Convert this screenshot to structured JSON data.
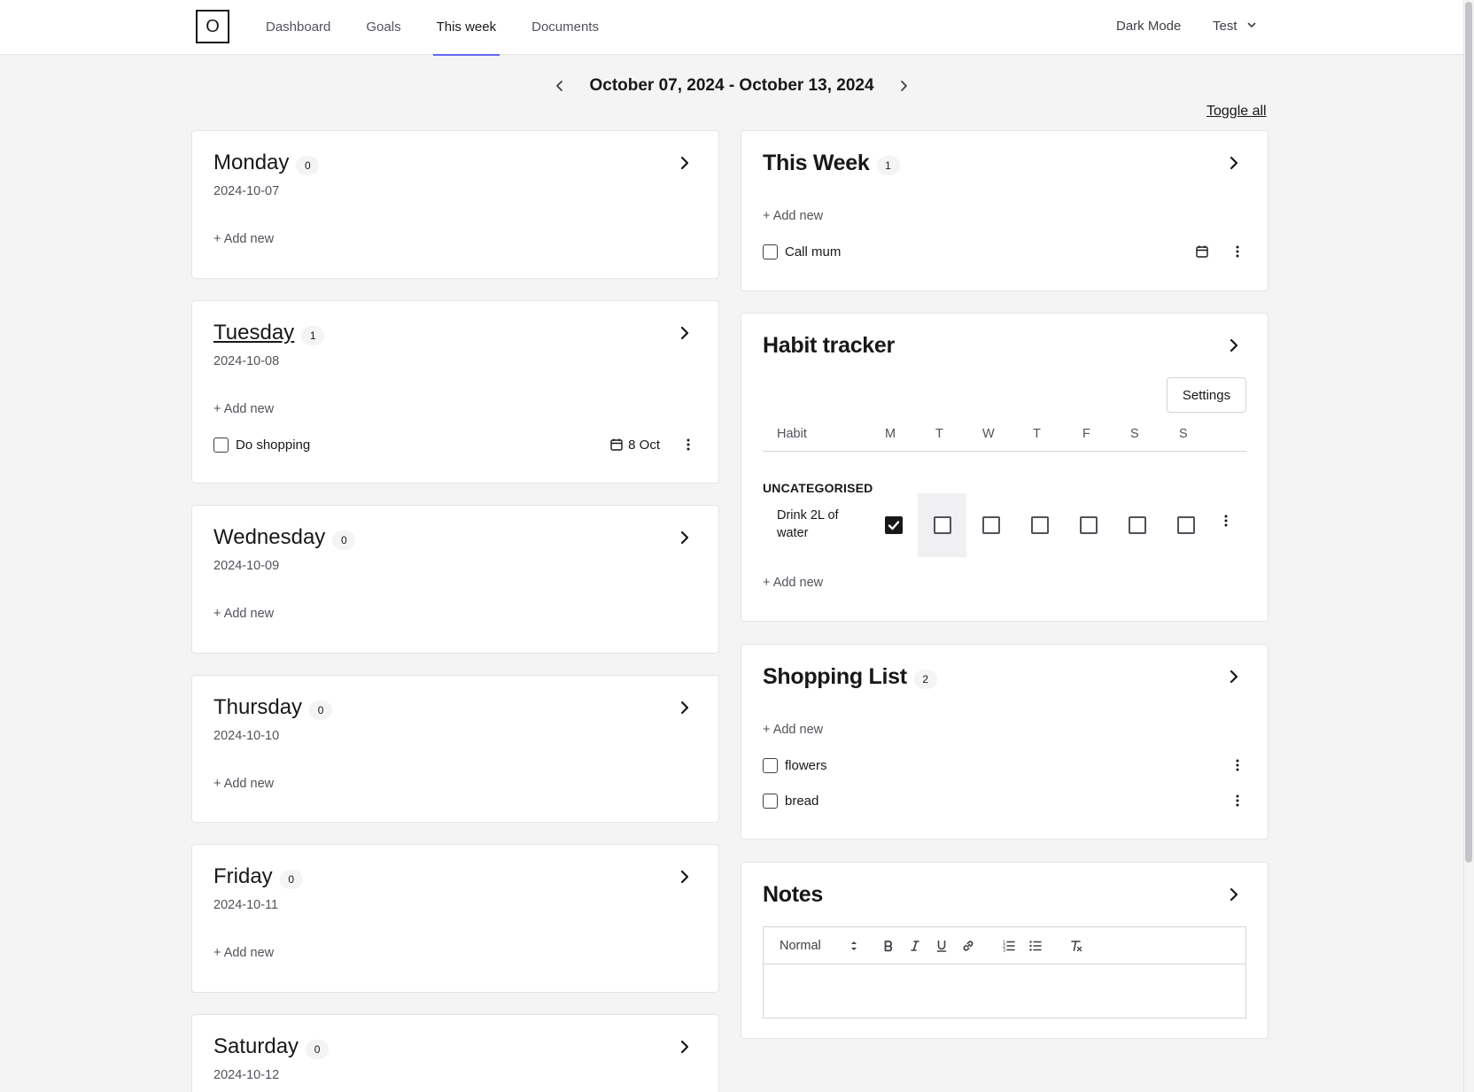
{
  "header": {
    "logo": "O",
    "nav": [
      "Dashboard",
      "Goals",
      "This week",
      "Documents"
    ],
    "active_nav": "This week",
    "dark_mode": "Dark Mode",
    "user": "Test"
  },
  "week": {
    "range": "October 07, 2024 - October 13, 2024",
    "toggle_all": "Toggle all"
  },
  "days": [
    {
      "name": "Monday",
      "count": "0",
      "date": "2024-10-07",
      "add": "+ Add new",
      "tasks": []
    },
    {
      "name": "Tuesday",
      "count": "1",
      "date": "2024-10-08",
      "add": "+ Add new",
      "tasks": [
        {
          "text": "Do shopping",
          "due": "8 Oct",
          "done": false
        }
      ]
    },
    {
      "name": "Wednesday",
      "count": "0",
      "date": "2024-10-09",
      "add": "+ Add new",
      "tasks": []
    },
    {
      "name": "Thursday",
      "count": "0",
      "date": "2024-10-10",
      "add": "+ Add new",
      "tasks": []
    },
    {
      "name": "Friday",
      "count": "0",
      "date": "2024-10-11",
      "add": "+ Add new",
      "tasks": []
    },
    {
      "name": "Saturday",
      "count": "0",
      "date": "2024-10-12",
      "add": "+ Add new",
      "tasks": []
    }
  ],
  "this_week": {
    "title": "This Week",
    "count": "1",
    "add": "+ Add new",
    "tasks": [
      {
        "text": "Call mum",
        "done": false
      }
    ]
  },
  "habit_tracker": {
    "title": "Habit tracker",
    "settings": "Settings",
    "columns": [
      "Habit",
      "M",
      "T",
      "W",
      "T",
      "F",
      "S",
      "S"
    ],
    "category": "UNCATEGORISED",
    "habits": [
      {
        "name": "Drink 2L of water",
        "days": [
          true,
          false,
          false,
          false,
          false,
          false,
          false
        ]
      }
    ],
    "highlight_day": "T",
    "add": "+ Add new"
  },
  "shopping": {
    "title": "Shopping List",
    "count": "2",
    "add": "+ Add new",
    "items": [
      {
        "text": "flowers",
        "done": false
      },
      {
        "text": "bread",
        "done": false
      }
    ]
  },
  "notes": {
    "title": "Notes",
    "format": "Normal",
    "toolbar": [
      "bold-icon",
      "italic-icon",
      "underline-icon",
      "link-icon",
      "ordered-list-icon",
      "bullet-list-icon",
      "clear-format-icon"
    ],
    "content": ""
  },
  "colors": {
    "accent": "#6366f1",
    "background": "#f4f4f5",
    "card": "#ffffff",
    "text": "#18181b",
    "muted": "#52525b"
  }
}
